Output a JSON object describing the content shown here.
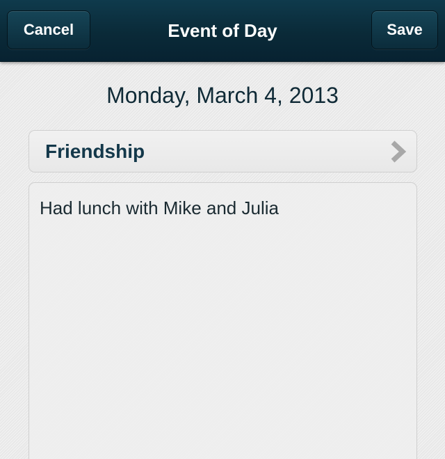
{
  "navbar": {
    "title": "Event of Day",
    "cancel_label": "Cancel",
    "save_label": "Save"
  },
  "event": {
    "date": "Monday, March 4, 2013",
    "category": "Friendship",
    "note": "Had lunch with Mike and Julia"
  },
  "icons": {
    "category_arrow": "chevron-right-icon"
  },
  "colors": {
    "navbar": "#0a2a38",
    "text_dark": "#0f2a36",
    "category_text": "#13384a",
    "chevron": "#a8a8a8"
  }
}
